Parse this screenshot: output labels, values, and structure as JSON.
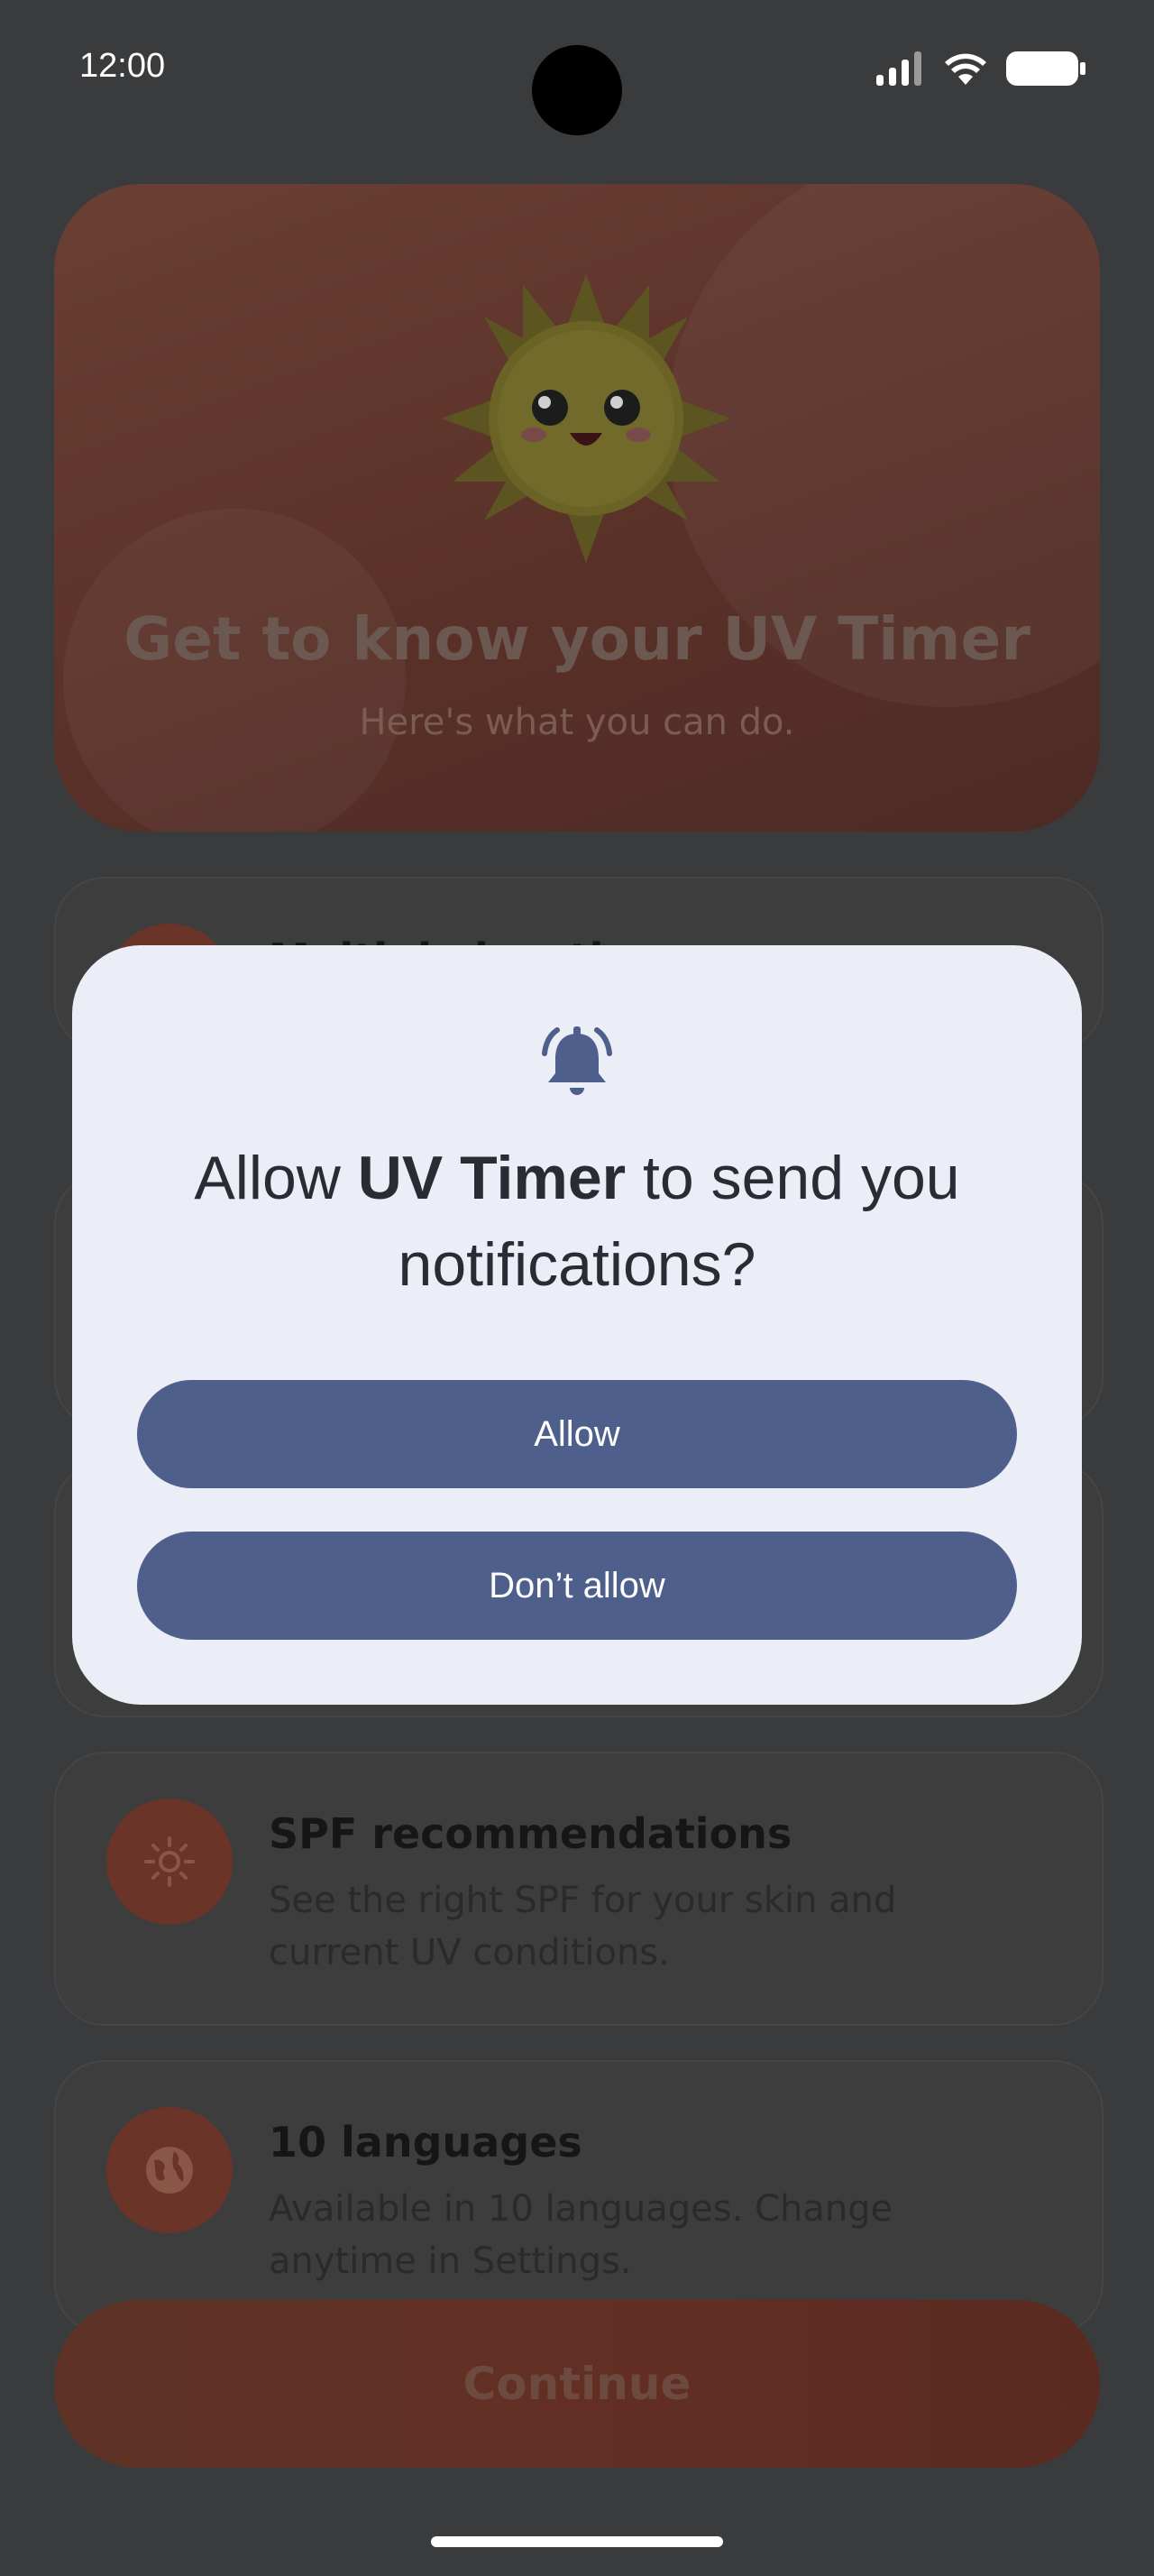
{
  "status_bar": {
    "time": "12:00"
  },
  "hero": {
    "title": "Get to know your UV Timer",
    "subtitle": "Here's what you can do."
  },
  "features": [
    {
      "title": "Multiple locations",
      "desc": "",
      "icon": "location-icon"
    },
    {
      "title": "SPF recommendations",
      "desc": "See the right SPF for your skin and current UV conditions.",
      "icon": "sun-icon"
    },
    {
      "title": "10 languages",
      "desc": "Available in 10 languages. Change anytime in Settings.",
      "icon": "globe-icon"
    }
  ],
  "continue_label": "Continue",
  "dialog": {
    "title_prefix": "Allow ",
    "app_name": "UV Timer",
    "title_suffix": " to send you notifications?",
    "allow_label": "Allow",
    "deny_label": "Don’t allow",
    "icon": "bell-icon"
  },
  "colors": {
    "dialog_bg": "#eceef7",
    "button": "#4e5f8c",
    "accent": "#6a3428"
  }
}
